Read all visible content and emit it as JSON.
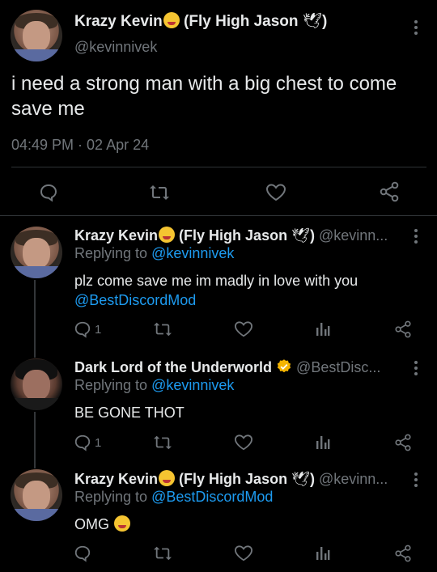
{
  "main_tweet": {
    "name": "Krazy Kevin",
    "name_suffix": " (Fly High Jason",
    "name_close": ")",
    "handle": "@kevinnivek",
    "text": "i need a strong man with a big chest to come save me",
    "timestamp": "04:49 PM · 02 Apr 24"
  },
  "replies": [
    {
      "name": "Krazy Kevin",
      "name_suffix": " (Fly High Jason",
      "name_close": ")",
      "handle": "@kevinn...",
      "replying_prefix": "Replying to ",
      "replying_to": "@kevinnivek",
      "text": "plz come save me im madly in love with you",
      "mention": "@BestDiscordMod",
      "reply_count": "1"
    },
    {
      "name": "Dark Lord of the Underworld",
      "handle": "@BestDisc...",
      "replying_prefix": "Replying to ",
      "replying_to": "@kevinnivek",
      "text": "BE GONE THOT",
      "reply_count": "1"
    },
    {
      "name": "Krazy Kevin",
      "name_suffix": " (Fly High Jason",
      "name_close": ")",
      "handle": "@kevinn...",
      "replying_prefix": "Replying to ",
      "replying_to": "@BestDiscordMod",
      "text": "OMG",
      "reply_count": ""
    }
  ],
  "icons": [
    "reply-icon",
    "retweet-icon",
    "like-icon",
    "share-icon",
    "views-icon",
    "more-icon",
    "verified-icon",
    "dove-icon",
    "emoji-icon"
  ],
  "colors": {
    "background": "#000000",
    "text": "#e7e9ea",
    "muted": "#71767b",
    "link": "#1d9bf0",
    "verified": "#f4b400"
  }
}
